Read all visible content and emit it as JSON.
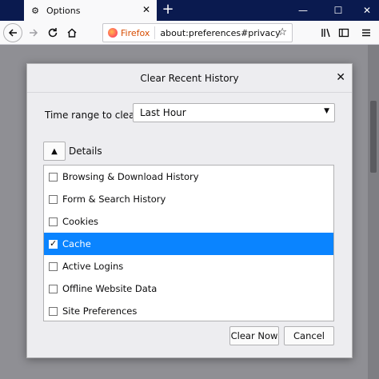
{
  "window": {
    "tab_title": "Options",
    "tab_icon": "gear-icon",
    "controls": {
      "minimize": "—",
      "maximize": "☐",
      "close": "✕"
    }
  },
  "toolbar": {
    "url_identity": "Firefox",
    "url": "about:preferences#privacy"
  },
  "dialog": {
    "title": "Clear Recent History",
    "time_range_label": "Time range to clear:",
    "time_range_value": "Last Hour",
    "details_label": "Details",
    "items": [
      {
        "label": "Browsing & Download History",
        "checked": false,
        "selected": false
      },
      {
        "label": "Form & Search History",
        "checked": false,
        "selected": false
      },
      {
        "label": "Cookies",
        "checked": false,
        "selected": false
      },
      {
        "label": "Cache",
        "checked": true,
        "selected": true
      },
      {
        "label": "Active Logins",
        "checked": false,
        "selected": false
      },
      {
        "label": "Offline Website Data",
        "checked": false,
        "selected": false
      },
      {
        "label": "Site Preferences",
        "checked": false,
        "selected": false
      }
    ],
    "clear_now_label": "Clear Now",
    "cancel_label": "Cancel"
  },
  "colors": {
    "accent": "#0a84ff",
    "tabstrip": "#0a1a4f"
  }
}
